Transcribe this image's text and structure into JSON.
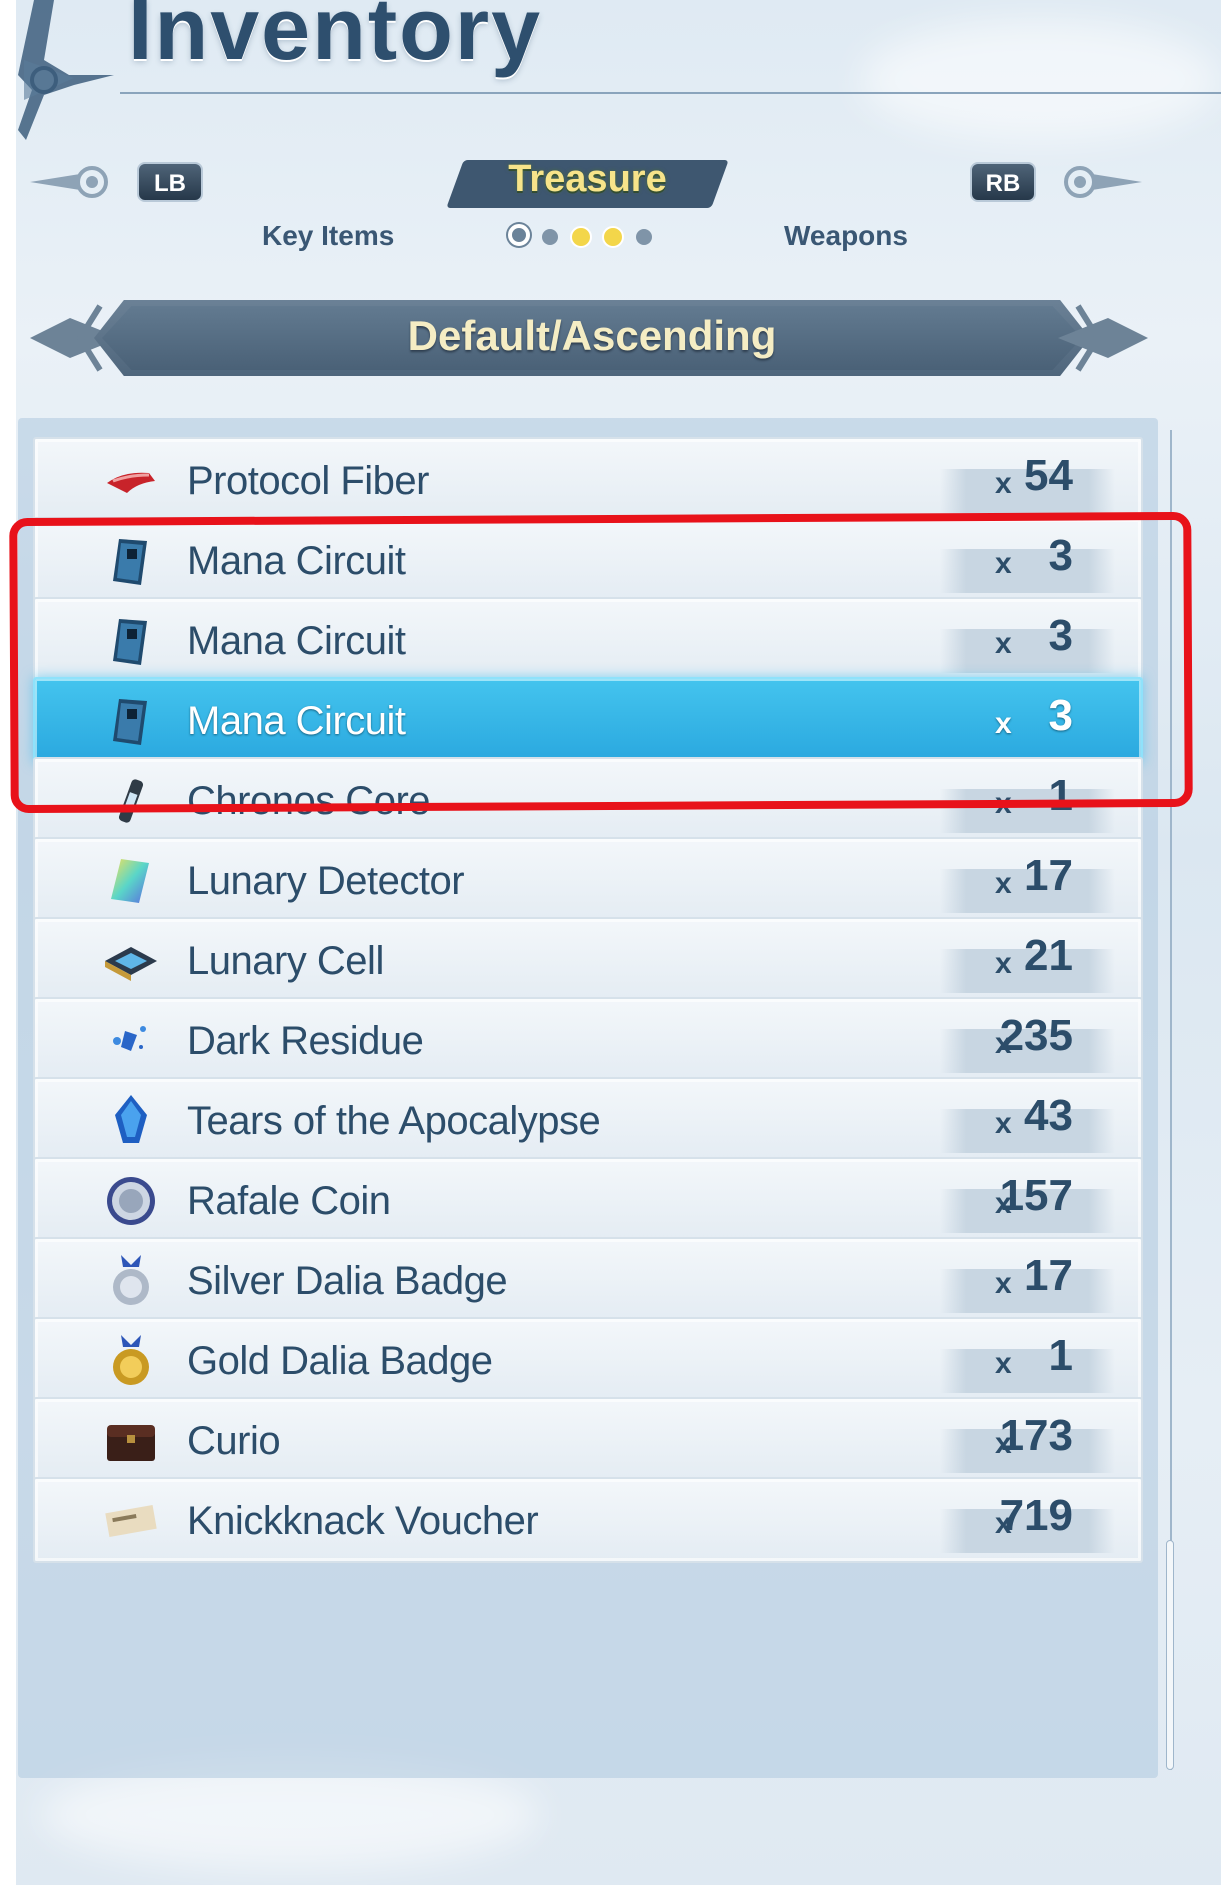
{
  "header": {
    "title": "Inventory"
  },
  "tabs": {
    "prev_button": "LB",
    "next_button": "RB",
    "current": "Treasure",
    "prev_label": "Key Items",
    "next_label": "Weapons",
    "page_dots": [
      {
        "state": "current-ring"
      },
      {
        "state": "grey"
      },
      {
        "state": "yellow"
      },
      {
        "state": "yellow"
      },
      {
        "state": "grey"
      }
    ]
  },
  "sort": {
    "label": "Default/Ascending"
  },
  "items": [
    {
      "name": "Protocol Fiber",
      "x": "x",
      "qty": "54",
      "icon": "protocol-fiber-icon"
    },
    {
      "name": "Mana Circuit",
      "x": "x",
      "qty": "3",
      "icon": "mana-circuit-icon"
    },
    {
      "name": "Mana Circuit",
      "x": "x",
      "qty": "3",
      "icon": "mana-circuit-icon"
    },
    {
      "name": "Mana Circuit",
      "x": "x",
      "qty": "3",
      "icon": "mana-circuit-icon",
      "selected": true
    },
    {
      "name": "Chronos Core",
      "x": "x",
      "qty": "1",
      "icon": "chronos-core-icon"
    },
    {
      "name": "Lunary Detector",
      "x": "x",
      "qty": "17",
      "icon": "lunary-detector-icon"
    },
    {
      "name": "Lunary Cell",
      "x": "x",
      "qty": "21",
      "icon": "lunary-cell-icon"
    },
    {
      "name": "Dark Residue",
      "x": "x",
      "qty": "235",
      "icon": "dark-residue-icon"
    },
    {
      "name": "Tears of the Apocalypse",
      "x": "x",
      "qty": "43",
      "icon": "tears-apocalypse-icon"
    },
    {
      "name": "Rafale Coin",
      "x": "x",
      "qty": "157",
      "icon": "rafale-coin-icon"
    },
    {
      "name": "Silver Dalia Badge",
      "x": "x",
      "qty": "17",
      "icon": "silver-badge-icon"
    },
    {
      "name": "Gold Dalia Badge",
      "x": "x",
      "qty": "1",
      "icon": "gold-badge-icon"
    },
    {
      "name": "Curio",
      "x": "x",
      "qty": "173",
      "icon": "curio-chest-icon"
    },
    {
      "name": "Knickknack Voucher",
      "x": "x",
      "qty": "719",
      "icon": "voucher-icon"
    }
  ],
  "colors": {
    "title": "#2e4f6e",
    "tab_active_text": "#f7e48a",
    "selected_row": "#2aa8df",
    "highlight_outline": "#e8121a"
  }
}
